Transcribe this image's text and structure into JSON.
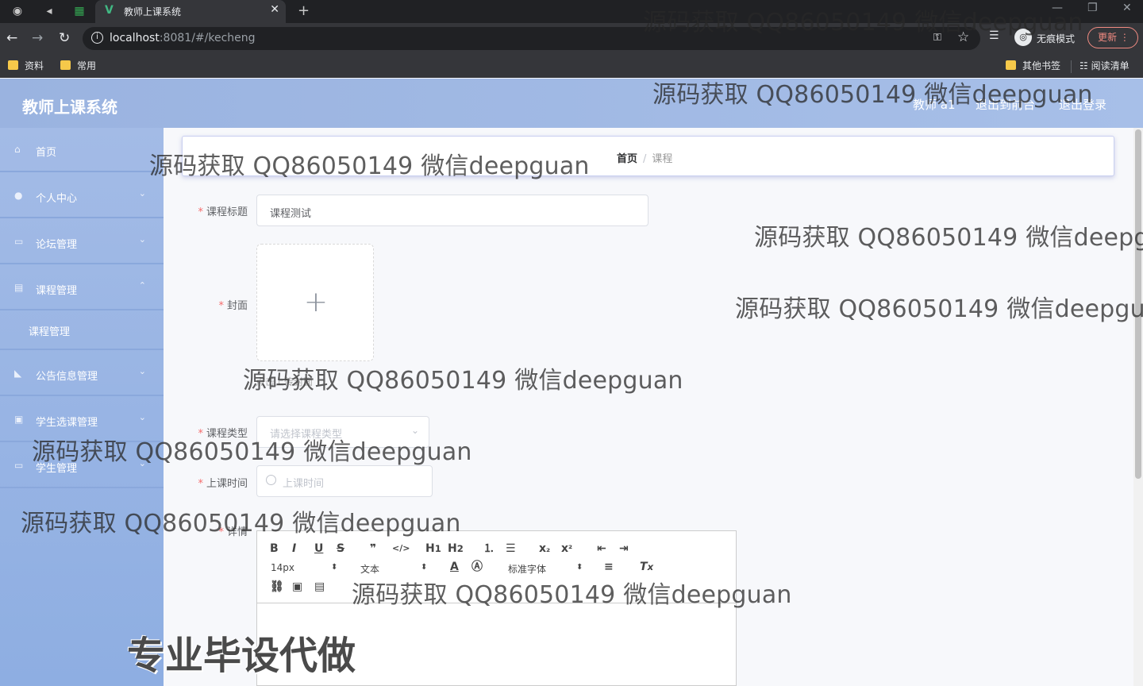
{
  "browser": {
    "tab_title": "教师上课系统",
    "url_host": "localhost",
    "url_rest": ":8081/#/kecheng",
    "incognito_label": "无痕模式",
    "update_label": "更新",
    "bookmarks": [
      "资料",
      "常用"
    ],
    "bookmarks_right": [
      "其他书签",
      "阅读清单"
    ]
  },
  "header": {
    "title": "教师上课系统",
    "user": "教师 a1",
    "to_front": "退出到前台",
    "logout": "退出登录"
  },
  "sidebar": {
    "items": [
      {
        "label": "首页",
        "icon": "home-icon"
      },
      {
        "label": "个人中心",
        "icon": "user-icon"
      },
      {
        "label": "论坛管理",
        "icon": "forum-icon"
      },
      {
        "label": "课程管理",
        "icon": "course-icon"
      },
      {
        "label": "课程管理",
        "icon": "none"
      },
      {
        "label": "公告信息管理",
        "icon": "notice-icon"
      },
      {
        "label": "学生选课管理",
        "icon": "select-icon"
      },
      {
        "label": "学生管理",
        "icon": "student-icon"
      }
    ]
  },
  "breadcrumb": {
    "home": "首页",
    "separator": "/",
    "current": "课程"
  },
  "form": {
    "title_label": "课程标题",
    "title_value": "课程测试",
    "cover_label": "封面",
    "cover_tip": "点击上传封面",
    "type_label": "课程类型",
    "type_placeholder": "请选择课程类型",
    "time_label": "上课时间",
    "time_placeholder": "上课时间",
    "detail_label": "详情"
  },
  "editor": {
    "size": "14px",
    "header": "文本",
    "font": "标准字体"
  },
  "watermark": {
    "text": "源码获取 QQ86050149 微信deepguan",
    "big": "专业毕设代做"
  },
  "colors": {
    "accent": "#9ab3e0",
    "required": "#f56c6c"
  }
}
